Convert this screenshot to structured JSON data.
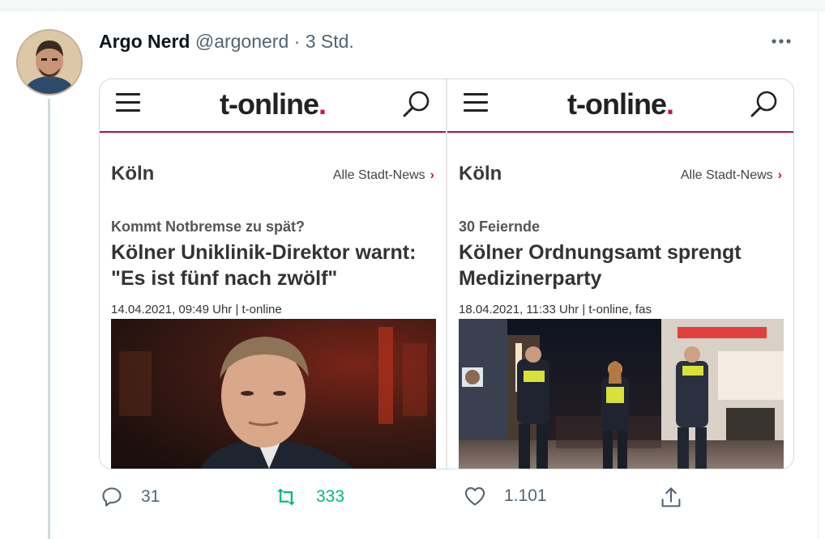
{
  "tweet": {
    "author_name": "Argo Nerd",
    "author_handle": "@argonerd",
    "separator": "·",
    "time": "3 Std.",
    "more_icon": "more-horizontal-icon"
  },
  "panels": [
    {
      "logo_text": "t-online",
      "logo_dot": ".",
      "city": "Köln",
      "all_news": "Alle Stadt-News",
      "chevron": "›",
      "kicker": "Kommt Notbremse zu spät?",
      "headline": "Kölner Uniklinik-Direktor warnt: \"Es ist fünf nach zwölf\"",
      "dateline": "14.04.2021, 09:49 Uhr | t-online"
    },
    {
      "logo_text": "t-online",
      "logo_dot": ".",
      "city": "Köln",
      "all_news": "Alle Stadt-News",
      "chevron": "›",
      "kicker": "30 Feiernde",
      "headline": "Kölner Ordnungsamt sprengt Medizinerparty",
      "dateline": "18.04.2021, 11:33 Uhr | t-online, fas"
    }
  ],
  "actions": {
    "reply_count": "31",
    "retweet_count": "333",
    "like_count": "1.101"
  },
  "colors": {
    "brand_magenta": "#c4116a",
    "retweet_green": "#00ba7c",
    "muted": "#536471"
  }
}
